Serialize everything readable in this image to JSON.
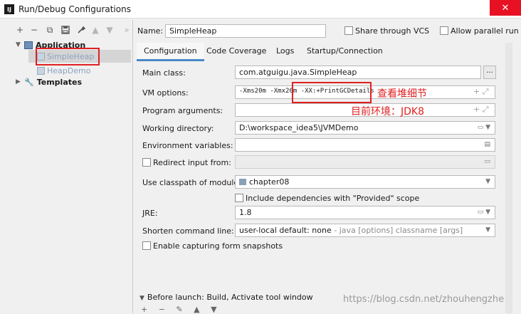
{
  "window": {
    "title": "Run/Debug Configurations",
    "app_icon": "IJ",
    "close_glyph": "✕"
  },
  "left_toolbar": {
    "add": "+",
    "remove": "−",
    "copy": "⧉",
    "save": "💾",
    "wrench": "🔧",
    "up": "▲",
    "down": "▼",
    "more": "»"
  },
  "tree": {
    "application_label": "Application",
    "items": [
      {
        "label": "SimpleHeap",
        "selected": true
      },
      {
        "label": "HeapDemo",
        "selected": false
      }
    ],
    "templates_label": "Templates"
  },
  "header": {
    "name_label": "Name:",
    "name_value": "SimpleHeap",
    "share_label": "Share through VCS",
    "parallel_label": "Allow parallel run"
  },
  "tabs": [
    "Configuration",
    "Code Coverage",
    "Logs",
    "Startup/Connection"
  ],
  "form": {
    "main_class_label": "Main class:",
    "main_class_value": "com.atguigu.java.SimpleHeap",
    "browse_label": "...",
    "vm_options_label": "VM options:",
    "vm_options_value": "-Xms20m -Xmx20m -XX:+PrintGCDetails",
    "program_args_label": "Program arguments:",
    "working_dir_label": "Working directory:",
    "working_dir_value": "D:\\workspace_idea5\\JVMDemo",
    "env_vars_label": "Environment variables:",
    "redirect_label": "Redirect input from:",
    "classpath_label": "Use classpath of module:",
    "classpath_value": "chapter08",
    "include_deps_label": "Include dependencies with \"Provided\" scope",
    "jre_label": "JRE:",
    "jre_value": "1.8",
    "shorten_label": "Shorten command line:",
    "shorten_value": "user-local default: none",
    "shorten_hint": " - java [options] classname [args]",
    "capture_label": "Enable capturing form snapshots"
  },
  "annotations": {
    "vm_note": "查看堆细节",
    "env_note": "目前环境：JDK8"
  },
  "before_launch": {
    "label": "Before launch: Build, Activate tool window"
  },
  "watermark": "https://blog.csdn.net/zhouhengzhe",
  "colors": {
    "accent": "#4a88c7",
    "annotation_red": "#e02020",
    "close_red": "#e81123"
  }
}
